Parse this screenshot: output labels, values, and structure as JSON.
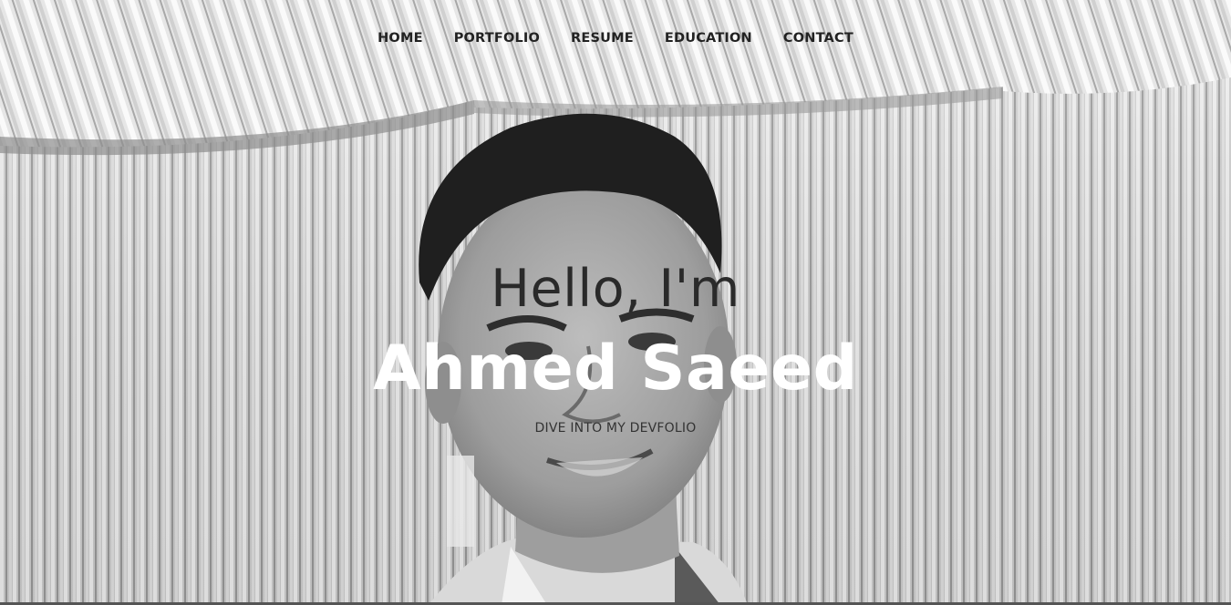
{
  "nav": {
    "items": [
      {
        "label": "HOME"
      },
      {
        "label": "PORTFOLIO"
      },
      {
        "label": "RESUME"
      },
      {
        "label": "EDUCATION"
      },
      {
        "label": "CONTACT"
      }
    ]
  },
  "hero": {
    "greeting": "Hello, I'm",
    "name": "Ahmed Saeed",
    "tagline": "DIVE INTO MY DEVFOLIO",
    "background": "grayscale-portrait-photo",
    "colors": {
      "nav_text": "#222222",
      "greeting_text": "#2a2a2a",
      "name_text": "#ffffff"
    }
  }
}
